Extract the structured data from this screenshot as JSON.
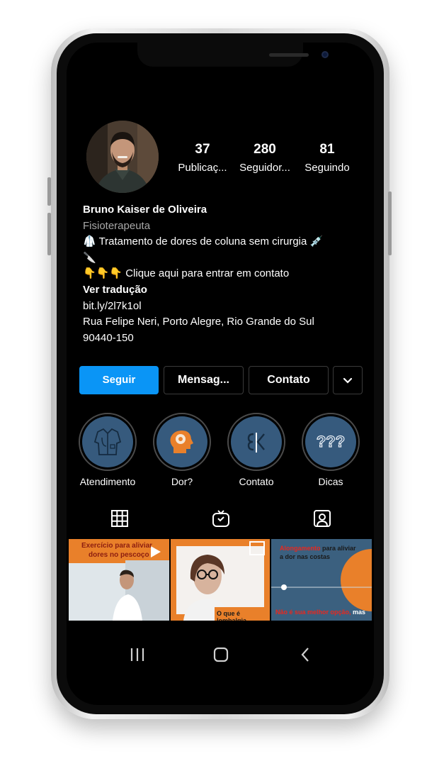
{
  "profile": {
    "stats": [
      {
        "value": "37",
        "label": "Publicaç..."
      },
      {
        "value": "280",
        "label": "Seguidor..."
      },
      {
        "value": "81",
        "label": "Seguindo"
      }
    ],
    "name": "Bruno Kaiser de Oliveira",
    "category": "Fisioterapeuta",
    "bio_line1": "🥼 Tratamento de dores de coluna sem cirurgia 💉",
    "bio_line1_cont": "🔪",
    "bio_line2": "👇👇👇 Clique aqui para entrar em contato",
    "translate": "Ver tradução",
    "link": "bit.ly/2l7k1ol",
    "address_line1": "Rua Felipe Neri, Porto Alegre, Rio Grande do Sul",
    "address_line2": "90440-150"
  },
  "buttons": {
    "follow": "Seguir",
    "message": "Mensag...",
    "contact": "Contato",
    "more_icon": "chevron-down-icon"
  },
  "highlights": [
    {
      "label": "Atendimento",
      "icon": "lab-coat-icon"
    },
    {
      "label": "Dor?",
      "icon": "head-brain-icon"
    },
    {
      "label": "Contato",
      "icon": "logo-bk-icon"
    },
    {
      "label": "Dicas",
      "icon": "question-marks-icon"
    }
  ],
  "tabs": [
    "grid-icon",
    "igtv-icon",
    "tagged-icon"
  ],
  "posts": [
    {
      "title_line1": "Exercício para aliviar",
      "title_line2": "dores no pescoço"
    },
    {
      "caption": "O que é lombalgia"
    },
    {
      "title_red": "Alongamento",
      "title_rest": " para aliviar",
      "title_line2": "a dor nas costas",
      "footer_red": "Não é sua melhor opção,",
      "footer_rest": " mas"
    }
  ],
  "colors": {
    "accent": "#0a95f6",
    "highlight_bg": "#365a7d",
    "post_orange": "#e9802a",
    "post_red": "#e8281f"
  }
}
